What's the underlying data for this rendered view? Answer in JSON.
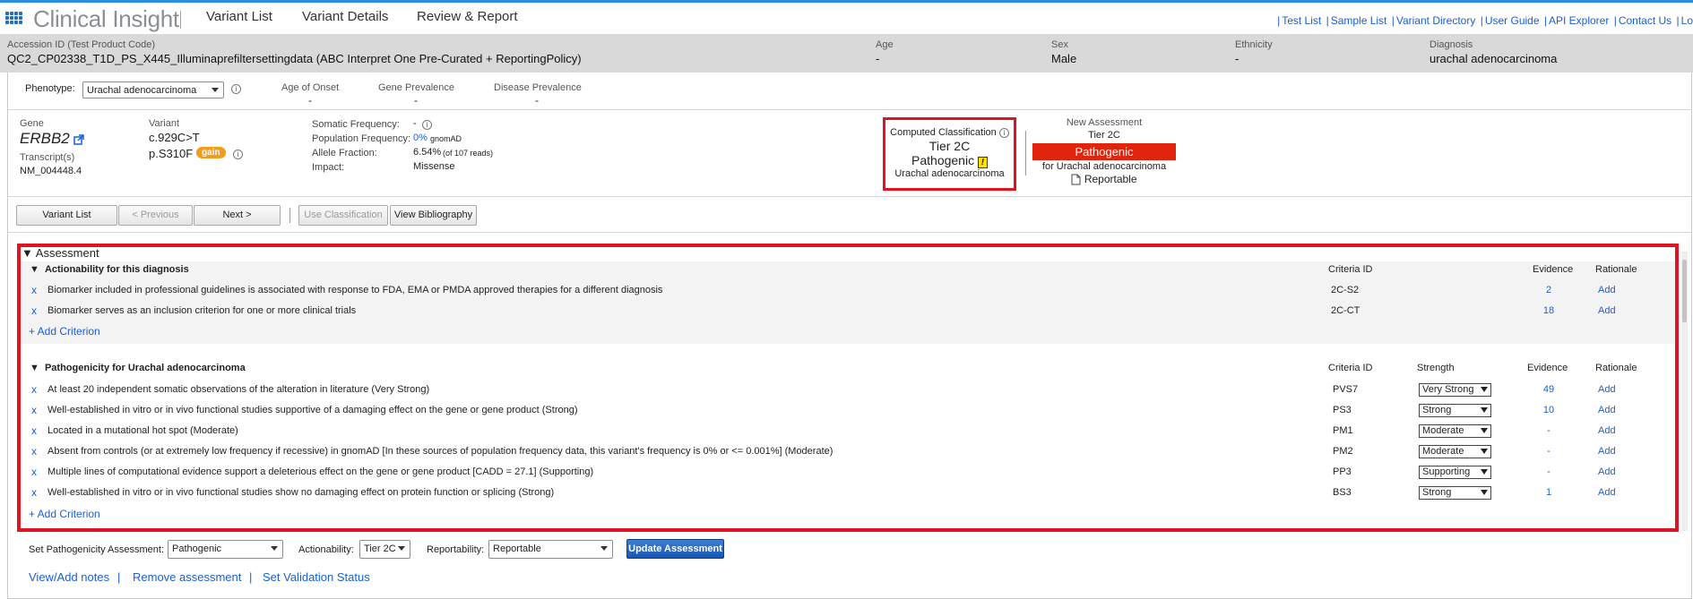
{
  "app": {
    "logo_text": "Clinical Insight"
  },
  "nav": {
    "tabs": [
      "Variant List",
      "Variant Details",
      "Review & Report"
    ],
    "active": "Variant Details"
  },
  "top_links": [
    "Test List",
    "Sample List",
    "Variant Directory",
    "User Guide",
    "API Explorer",
    "Contact Us",
    "Lo"
  ],
  "header": {
    "accession_label": "Accession ID (Test Product Code)",
    "accession_value": "QC2_CP02338_T1D_PS_X445_Illuminaprefiltersettingdata  (ABC Interpret One Pre-Curated + ReportingPolicy)",
    "age_label": "Age",
    "age_value": "-",
    "sex_label": "Sex",
    "sex_value": "Male",
    "ethnicity_label": "Ethnicity",
    "ethnicity_value": "-",
    "diagnosis_label": "Diagnosis",
    "diagnosis_value": "urachal adenocarcinoma"
  },
  "phenotype": {
    "label": "Phenotype:",
    "value": "Urachal adenocarcinoma",
    "age_onset_label": "Age of Onset",
    "age_onset_value": "-",
    "gene_prev_label": "Gene Prevalence",
    "gene_prev_value": "-",
    "disease_prev_label": "Disease Prevalence",
    "disease_prev_value": "-"
  },
  "variant": {
    "gene_label": "Gene",
    "gene": "ERBB2",
    "transcript_label": "Transcript(s)",
    "transcript": "NM_004448.4",
    "variant_label": "Variant",
    "cdna": "c.929C>T",
    "protein": "p.S310F",
    "gain_tag": "gain",
    "somatic_freq_label": "Somatic Frequency:",
    "somatic_freq_value": "-",
    "pop_freq_label": "Population Frequency:",
    "pop_freq_value": "0%",
    "pop_freq_source": "gnomAD",
    "allele_frac_label": "Allele Fraction:",
    "allele_frac_value": "6.54%",
    "allele_frac_reads": "(of 107 reads)",
    "impact_label": "Impact:",
    "impact_value": "Missense"
  },
  "computed": {
    "title": "Computed Classification",
    "tier": "Tier 2C",
    "path": "Pathogenic",
    "warn": "!",
    "diagnosis": "Urachal adenocarcinoma"
  },
  "new_assessment": {
    "title": "New Assessment",
    "tier": "Tier 2C",
    "path": "Pathogenic",
    "for": "for Urachal adenocarcinoma",
    "reportable": "Reportable"
  },
  "buttons": {
    "variant_list": "Variant List",
    "previous": "< Previous",
    "next": "Next >",
    "use_class": "Use Classification",
    "view_bib": "View Bibliography"
  },
  "assessment": {
    "title": "Assessment",
    "actionability": {
      "title": "Actionability for this diagnosis",
      "col_criteria": "Criteria ID",
      "col_evidence": "Evidence",
      "col_rationale": "Rationale",
      "rows": [
        {
          "x": "x",
          "text": "Biomarker included in professional guidelines is associated with response to FDA, EMA or PMDA approved therapies for a different diagnosis",
          "criteria": "2C-S2",
          "evidence": "2",
          "rationale": "Add"
        },
        {
          "x": "x",
          "text": "Biomarker serves as an inclusion criterion for one or more clinical trials",
          "criteria": "2C-CT",
          "evidence": "18",
          "rationale": "Add"
        }
      ],
      "add": "+ Add Criterion"
    },
    "pathogenicity": {
      "title": "Pathogenicity for Urachal adenocarcinoma",
      "col_criteria": "Criteria ID",
      "col_strength": "Strength",
      "col_evidence": "Evidence",
      "col_rationale": "Rationale",
      "rows": [
        {
          "x": "x",
          "text": "At least 20 independent somatic observations of the alteration in literature (Very Strong)",
          "criteria": "PVS7",
          "strength": "Very Strong",
          "evidence": "49",
          "rationale": "Add"
        },
        {
          "x": "x",
          "text": "Well-established in vitro or in vivo functional studies supportive of a damaging effect on the gene or gene product (Strong)",
          "criteria": "PS3",
          "strength": "Strong",
          "evidence": "10",
          "rationale": "Add"
        },
        {
          "x": "x",
          "text": "Located in a mutational hot spot (Moderate)",
          "criteria": "PM1",
          "strength": "Moderate",
          "evidence": "-",
          "rationale": "Add"
        },
        {
          "x": "x",
          "text": "Absent from controls (or at extremely low frequency if recessive) in gnomAD [In these sources of population frequency data, this variant's frequency is 0% or <= 0.001%] (Moderate)",
          "criteria": "PM2",
          "strength": "Moderate",
          "evidence": "-",
          "rationale": "Add"
        },
        {
          "x": "x",
          "text": "Multiple lines of computational evidence support a deleterious effect on the gene or gene product [CADD = 27.1] (Supporting)",
          "criteria": "PP3",
          "strength": "Supporting",
          "evidence": "-",
          "rationale": "Add"
        },
        {
          "x": "x",
          "text": "Well-established in vitro or in vivo functional studies show no damaging effect on protein function or splicing (Strong)",
          "criteria": "BS3",
          "strength": "Strong",
          "evidence": "1",
          "rationale": "Add"
        }
      ],
      "add": "+ Add Criterion"
    }
  },
  "set_assessment": {
    "path_label": "Set Pathogenicity Assessment:",
    "path_value": "Pathogenic",
    "action_label": "Actionability:",
    "action_value": "Tier 2C",
    "report_label": "Reportability:",
    "report_value": "Reportable",
    "update_btn": "Update Assessment"
  },
  "bottom_links": {
    "notes": "View/Add notes",
    "remove": "Remove assessment",
    "validation": "Set Validation Status",
    "sep": "|"
  }
}
